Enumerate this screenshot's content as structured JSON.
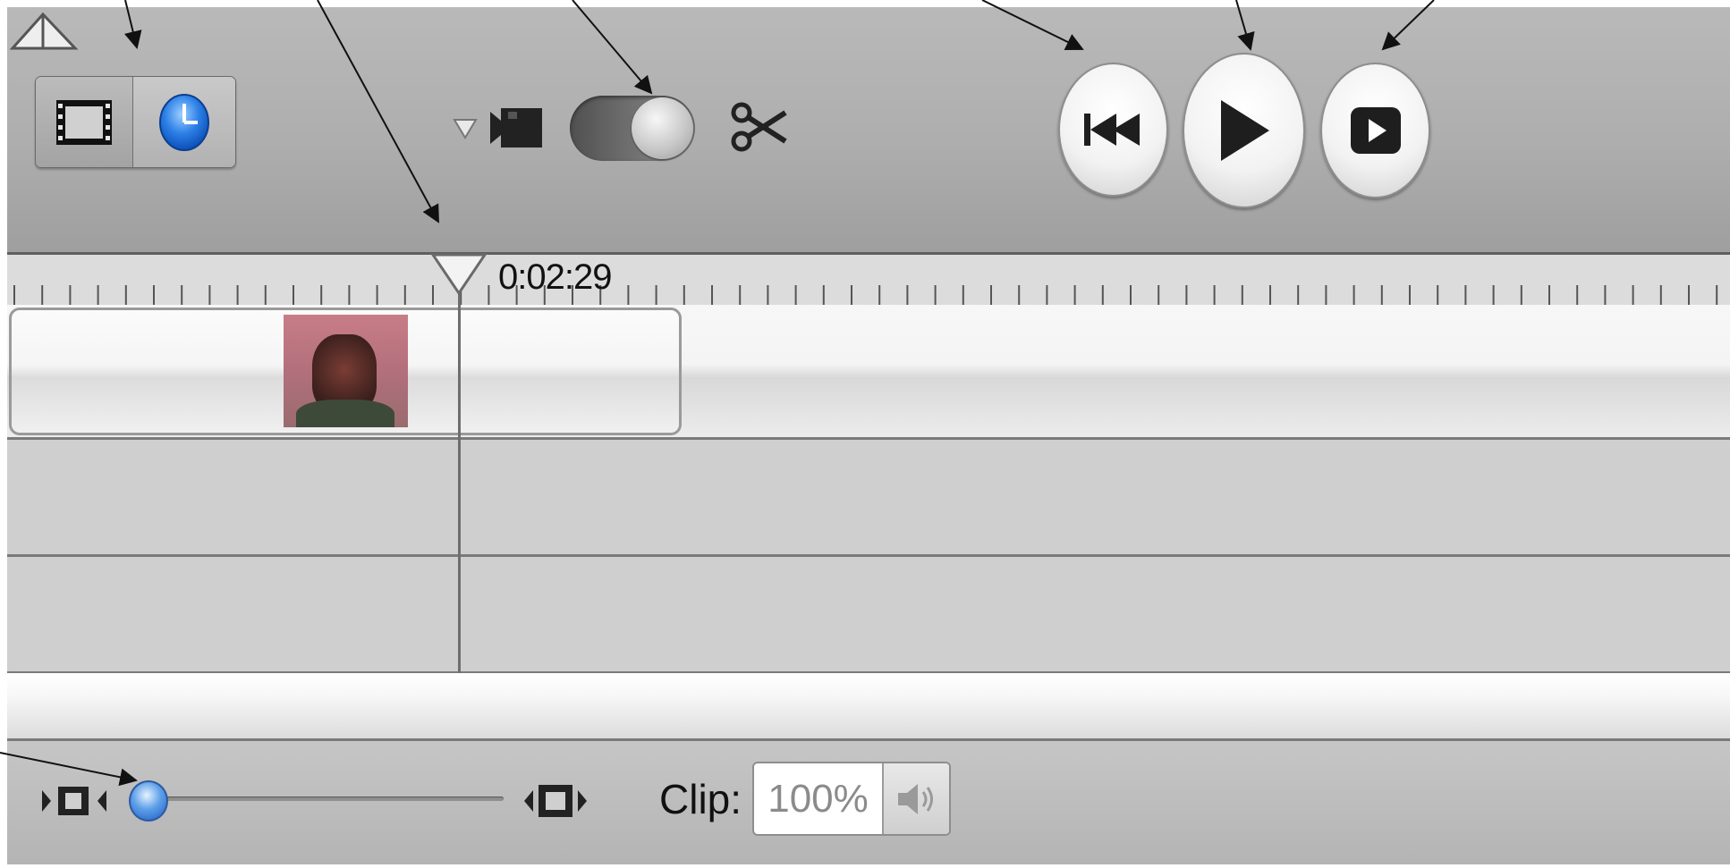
{
  "playhead": {
    "timecode": "0:02:29"
  },
  "toolbar": {
    "view_modes": [
      {
        "name": "clip-viewer",
        "icon": "film-frame-icon"
      },
      {
        "name": "timeline-viewer",
        "icon": "clock-icon",
        "selected": true
      }
    ],
    "camera_toggle": {
      "icon": "camera-icon",
      "state": "edit"
    },
    "controls": [
      {
        "name": "rewind",
        "icon": "rewind-to-start-icon"
      },
      {
        "name": "play",
        "icon": "play-icon"
      },
      {
        "name": "play-full-screen",
        "icon": "play-full-screen-icon"
      }
    ]
  },
  "bottom_bar": {
    "zoom_level": 0.0,
    "clip_label": "Clip:",
    "clip_volume": "100%",
    "volume_icon": "speaker-icon"
  },
  "colors": {
    "toolbar": "#aeaeae",
    "accent_blue": "#1f6fe0",
    "track": "#cfcfcf"
  }
}
